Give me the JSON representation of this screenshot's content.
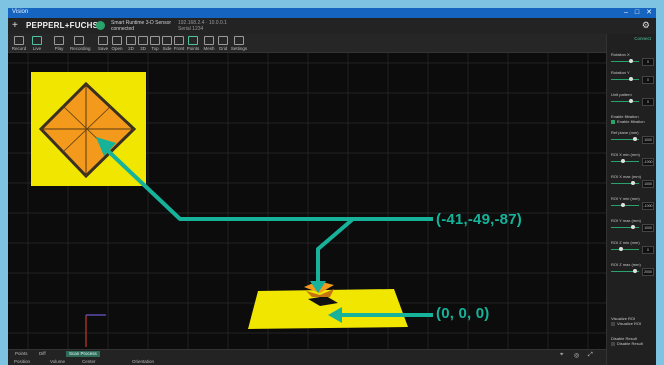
{
  "window": {
    "title": "Vision",
    "controls": [
      "–",
      "□",
      "✕"
    ]
  },
  "brand": {
    "name": "PEPPERL+FUCHS",
    "sensor_line1": "Smart Runtime 3-D Sensor",
    "sensor_line2": "connected",
    "sensor_detail1": "192.168.2.4 · 10.0.0.1",
    "sensor_detail2": "Serial 1234"
  },
  "toolbar": {
    "items": [
      "Record",
      "Live",
      "Play",
      "Recording",
      "Save",
      "Open",
      "2D",
      "3D",
      "Top",
      "Side",
      "Front",
      "Points",
      "Mesh",
      "Grid",
      "Settings"
    ]
  },
  "right_panel": {
    "top_button": "Connect",
    "controls": [
      {
        "label": "Rotation X",
        "value": "0"
      },
      {
        "label": "Rotation Y",
        "value": "0"
      },
      {
        "label": "Unit pattern",
        "value": "0"
      },
      {
        "label": "Enable filtration",
        "check": "Enable filtration"
      },
      {
        "label": "Ref plane (mm)",
        "value": "1000"
      },
      {
        "label": "ROI X min (mm)",
        "value": "-1000"
      },
      {
        "label": "ROI X max (mm)",
        "value": "1000"
      },
      {
        "label": "ROI Y min (mm)",
        "value": "-1000"
      },
      {
        "label": "ROI Y max (mm)",
        "value": "1000"
      },
      {
        "label": "ROI Z min (mm)",
        "value": "0"
      },
      {
        "label": "ROI Z max (mm)",
        "value": "2000"
      },
      {
        "label": "Visualize ROI",
        "check": "Visualize ROI"
      },
      {
        "label": "Disable Result",
        "check": "Disable Result"
      }
    ]
  },
  "bottom": {
    "tabs": [
      "Points",
      "Diff",
      "Scan Process"
    ],
    "active_tab": 2,
    "fields": [
      "Position",
      "Volume",
      "Center",
      "Orientation"
    ]
  },
  "annotations": {
    "callout_top": "(-41,-49,-87)",
    "callout_bottom": "(0, 0, 0)",
    "accent": "#16b39a",
    "object_color": "#f1e600",
    "cube_color": "#f39a1d"
  }
}
